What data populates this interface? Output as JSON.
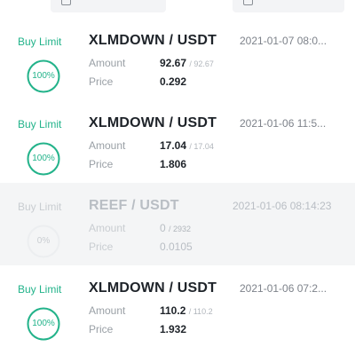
{
  "orders": [
    {
      "type": "Buy Limit",
      "pair": "XLMDOWN / USDT",
      "time": "2021-01-07 08:0...",
      "amount_label": "Amount",
      "price_label": "Price",
      "filled": "92.67",
      "total": "/ 92.67",
      "price": "0.292",
      "progress_text": "100%",
      "progress": 1.0,
      "status": "filled"
    },
    {
      "type": "Buy Limit",
      "pair": "XLMDOWN / USDT",
      "time": "2021-01-06 11:5...",
      "amount_label": "Amount",
      "price_label": "Price",
      "filled": "17.04",
      "total": "/ 17.04",
      "price": "1.806",
      "progress_text": "100%",
      "progress": 1.0,
      "status": "filled"
    },
    {
      "type": "Buy Limit",
      "pair": "REEF / USDT",
      "time": "2021-01-06 08:14:23",
      "amount_label": "Amount",
      "price_label": "Price",
      "filled": "0",
      "total": "/ 2932",
      "price": "0.0105",
      "progress_text": "0%",
      "progress": 0.0,
      "status": "cancelled"
    },
    {
      "type": "Buy Limit",
      "pair": "XLMDOWN / USDT",
      "time": "2021-01-06 07:2...",
      "amount_label": "Amount",
      "price_label": "Price",
      "filled": "110.2",
      "total": "/ 110.2",
      "price": "1.932",
      "progress_text": "100%",
      "progress": 1.0,
      "status": "filled"
    }
  ],
  "colors": {
    "accent": "#22b38a",
    "muted": "#c9cdd1",
    "cancelled_bg": "#f4f5f6"
  }
}
